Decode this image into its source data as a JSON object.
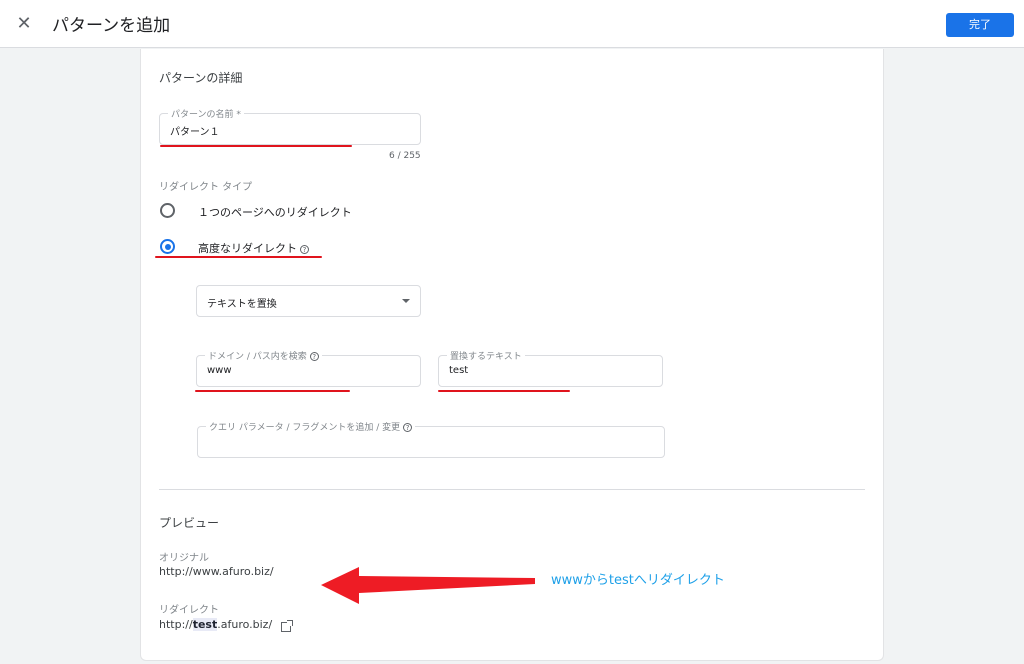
{
  "header": {
    "title": "パターンを追加",
    "done_label": "完了",
    "close_icon": "close-icon"
  },
  "details": {
    "section_title": "パターンの詳細",
    "name_label": "パターンの名前 *",
    "name_value": "パターン１",
    "name_counter": "6 / 255",
    "redirect_type_label": "リダイレクト タイプ",
    "options": [
      {
        "label": "１つのページへのリダイレクト",
        "checked": false
      },
      {
        "label": "高度なリダイレクト",
        "checked": true
      }
    ],
    "action_select": "テキストを置換",
    "search_label": "ドメイン / パス内を検索",
    "search_value": "www",
    "replace_label": "置換するテキスト",
    "replace_value": "test",
    "query_label": "クエリ パラメータ / フラグメントを追加 / 変更",
    "query_value": ""
  },
  "preview": {
    "section_title": "プレビュー",
    "original_label": "オリジナル",
    "original_url": "http://www.afuro.biz/",
    "redirect_label": "リダイレクト",
    "redirect_prefix": "http://",
    "redirect_highlight": "test",
    "redirect_suffix": ".afuro.biz/"
  },
  "annotation": {
    "text": "wwwからtestへリダイレクト",
    "color": "#1ea0e8",
    "arrow_color": "#ee1c25"
  },
  "colors": {
    "accent": "#1a73e8",
    "underline": "#e0141d"
  }
}
